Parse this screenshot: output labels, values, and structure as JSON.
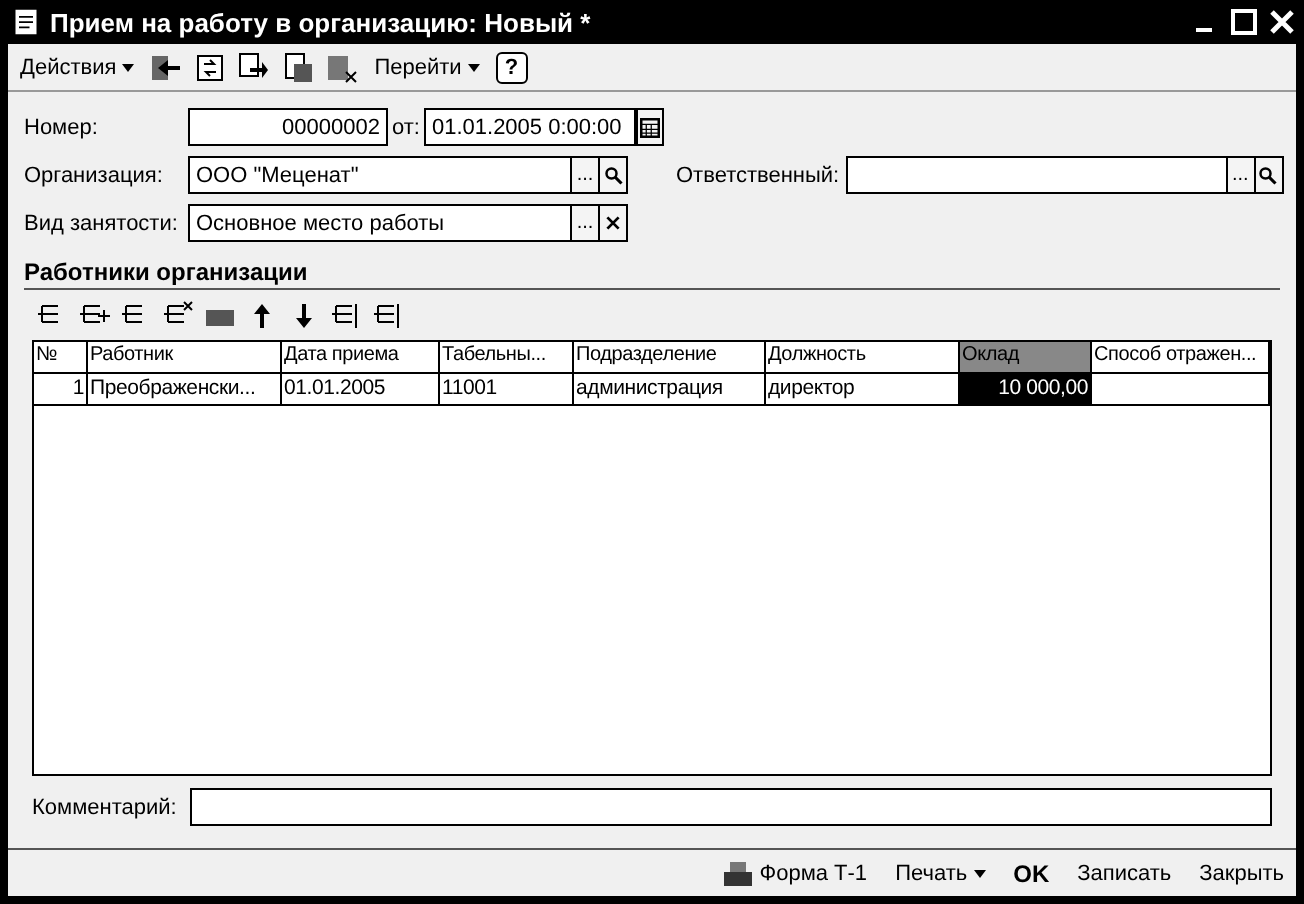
{
  "window": {
    "title": "Прием на работу в организацию: Новый *"
  },
  "toolbar": [
    {
      "kind": "menu",
      "label": "Действия"
    },
    {
      "kind": "icon"
    },
    {
      "kind": "icon"
    },
    {
      "kind": "icon"
    },
    {
      "kind": "icon"
    },
    {
      "kind": "icon"
    },
    {
      "kind": "menu",
      "label": "Перейти"
    },
    {
      "kind": "help",
      "label": "?"
    }
  ],
  "header": {
    "number_label": "Номер:",
    "number": "00000002",
    "date_label": "от:",
    "date": "01.01.2005  0:00:00",
    "organization": {
      "label": "Организация:",
      "value": "ООО \"Меценат\"",
      "choose": "..."
    },
    "responsible": {
      "label": "Ответственный:",
      "choose": "..."
    },
    "employment": {
      "label": "Вид занятости:",
      "value": "Основное место работы",
      "choose": "..."
    }
  },
  "section": {
    "title": "Работники организации"
  },
  "table": {
    "columns": [
      {
        "label": "№",
        "selected": false
      },
      {
        "label": "Работник",
        "selected": false
      },
      {
        "label": "Дата приема",
        "selected": false
      },
      {
        "label": "Табельны...",
        "selected": false
      },
      {
        "label": "Подразделение",
        "selected": false
      },
      {
        "label": "Должность",
        "selected": false
      },
      {
        "label": "Оклад",
        "selected": true
      },
      {
        "label": "Способ отражен...",
        "selected": false
      }
    ],
    "rows": [
      {
        "selected": true,
        "cells": [
          "1",
          "Преображенски...",
          "01.01.2005",
          "11001",
          "администрация",
          "директор",
          "10 000,00",
          ""
        ]
      }
    ]
  },
  "comment": {
    "label": "Комментарий:"
  },
  "footer": [
    {
      "kind": "print",
      "label": "Форма Т-1"
    },
    {
      "kind": "menu",
      "label": "Печать"
    },
    {
      "kind": "default",
      "label": "OK"
    },
    {
      "kind": "plain",
      "label": "Записать"
    },
    {
      "kind": "plain",
      "label": "Закрыть"
    }
  ]
}
